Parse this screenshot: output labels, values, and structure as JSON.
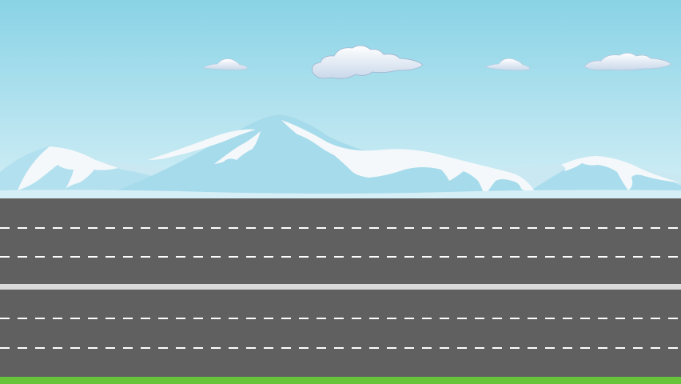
{
  "scene": {
    "sky_top_color": "#89d3e6",
    "sky_bottom_color": "#d4eff6",
    "mountain_far_color": "#b3e0ef",
    "mountain_near_color": "#a6dbeb",
    "snow_color": "#f4f8fa",
    "road_color": "#606060",
    "lane_marking_color": "#ffffff",
    "median_color": "#d9d9d9",
    "grass_color": "#66c43a",
    "clouds": [
      "cloud-small-left",
      "cloud-large-center",
      "cloud-small-right",
      "cloud-medium-far-right"
    ],
    "lanes_per_direction": 3
  }
}
